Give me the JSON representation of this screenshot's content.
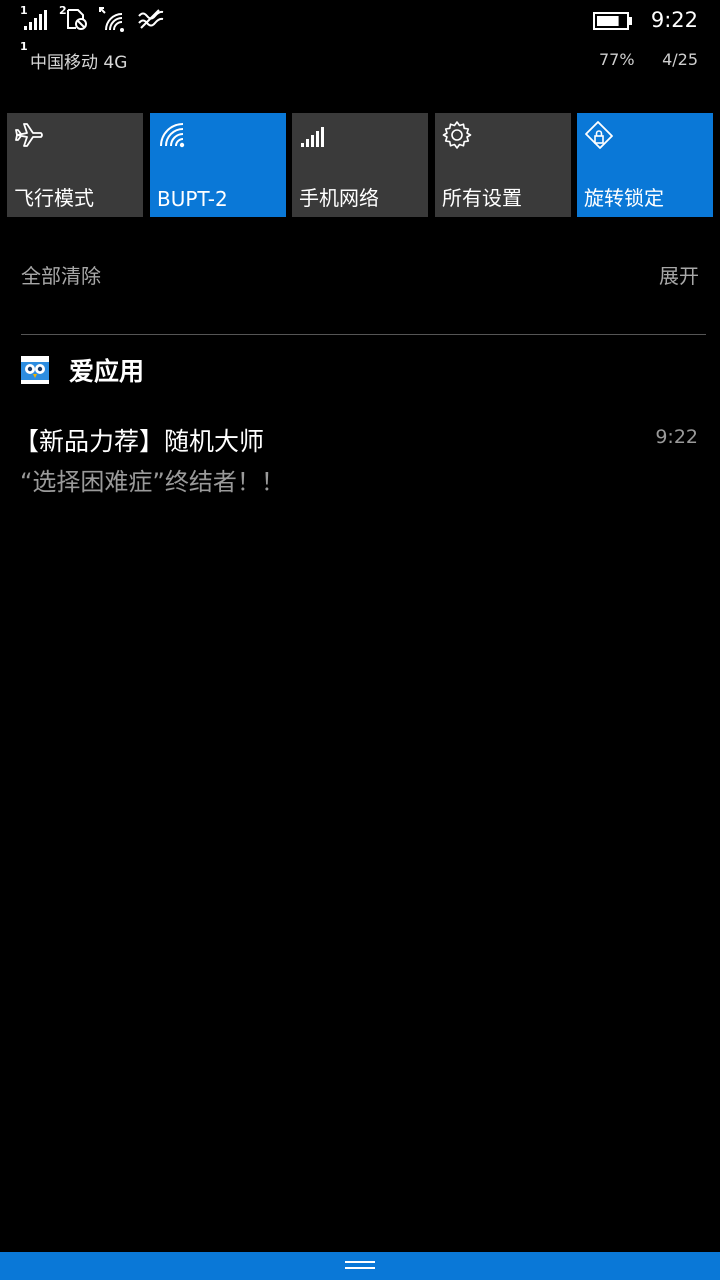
{
  "status_bar": {
    "sim1_label": "1",
    "sim2_label": "2",
    "carrier_sup": "1",
    "carrier": "中国移动 4G",
    "time": "9:22",
    "battery_percent": "77%",
    "battery_level": 0.77,
    "date": "4/25",
    "icons": [
      "signal-bars-icon",
      "sim2-no-service-icon",
      "wifi-icon",
      "vibrate-icon",
      "battery-icon"
    ]
  },
  "quick_actions": [
    {
      "label": "飞行模式",
      "icon": "airplane-icon",
      "active": false
    },
    {
      "label": "BUPT-2",
      "icon": "wifi-icon",
      "active": true
    },
    {
      "label": "手机网络",
      "icon": "cellular-icon",
      "active": false
    },
    {
      "label": "所有设置",
      "icon": "gear-icon",
      "active": false
    },
    {
      "label": "旋转锁定",
      "icon": "rotation-lock-icon",
      "active": true
    }
  ],
  "action_center": {
    "clear_all": "全部清除",
    "expand": "展开"
  },
  "notification": {
    "app_name": "爱应用",
    "title": "【新品力荐】随机大师",
    "time": "9:22",
    "body": "“选择困难症”终结者！！"
  },
  "colors": {
    "accent": "#0a78d7",
    "tile_inactive": "#3a3a3a",
    "background": "#000000"
  }
}
